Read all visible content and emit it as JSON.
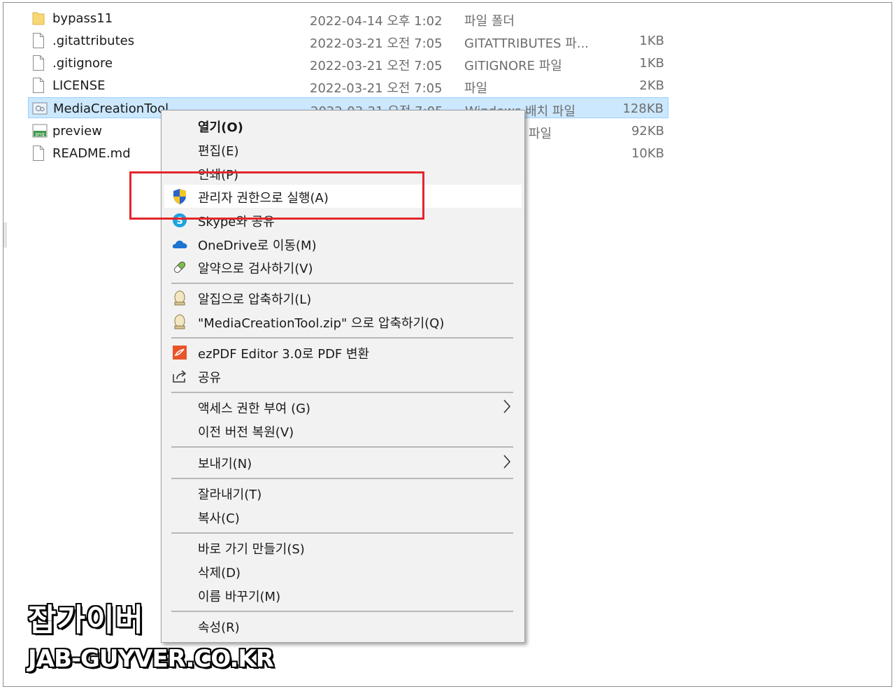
{
  "files": [
    {
      "name": "bypass11",
      "date": "2022-04-14 오후 1:02",
      "type": "파일 폴더",
      "size": "",
      "icon": "folder-icon"
    },
    {
      "name": ".gitattributes",
      "date": "2022-03-21 오전 7:05",
      "type": "GITATTRIBUTES 파...",
      "size": "1KB",
      "icon": "file-icon"
    },
    {
      "name": ".gitignore",
      "date": "2022-03-21 오전 7:05",
      "type": "GITIGNORE 파일",
      "size": "1KB",
      "icon": "file-icon"
    },
    {
      "name": "LICENSE",
      "date": "2022-03-21 오전 7:05",
      "type": "파일",
      "size": "2KB",
      "icon": "file-icon"
    },
    {
      "name": "MediaCreationTool",
      "date": "2022-03-21 오전 7:05",
      "type": "Windows 배치 파일",
      "size": "128KB",
      "icon": "batch-file-icon"
    },
    {
      "name": "preview",
      "date": "",
      "type": "파일",
      "size": "92KB",
      "icon": "png-file-icon"
    },
    {
      "name": "README.md",
      "date": "",
      "type": "",
      "size": "10KB",
      "icon": "file-icon"
    }
  ],
  "context_menu": {
    "open": "열기(O)",
    "edit": "편집(E)",
    "print": "인쇄(P)",
    "run_as_admin": "관리자 권한으로 실행(A)",
    "skype_share": "Skype와 공유",
    "onedrive_move": "OneDrive로 이동(M)",
    "alyac_scan": "알약으로 검사하기(V)",
    "alzip_compress": "알집으로 압축하기(L)",
    "alzip_compress_named": "\"MediaCreationTool.zip\" 으로 압축하기(Q)",
    "ezpdf_convert": "ezPDF Editor 3.0로 PDF 변환",
    "share": "공유",
    "grant_access": "액세스 권한 부여 (G)",
    "restore_previous": "이전 버전 복원(V)",
    "send_to": "보내기(N)",
    "cut": "잘라내기(T)",
    "copy": "복사(C)",
    "create_shortcut": "바로 가기 만들기(S)",
    "delete": "삭제(D)",
    "rename": "이름 바꾸기(M)",
    "properties": "속성(R)"
  },
  "watermark": {
    "name": "잡가이버",
    "site": "JAB-GUYVER.CO.KR"
  },
  "colors": {
    "selection": "#cce8ff",
    "highlight_box": "#e3262b",
    "menu_bg": "#f2f2f2"
  }
}
